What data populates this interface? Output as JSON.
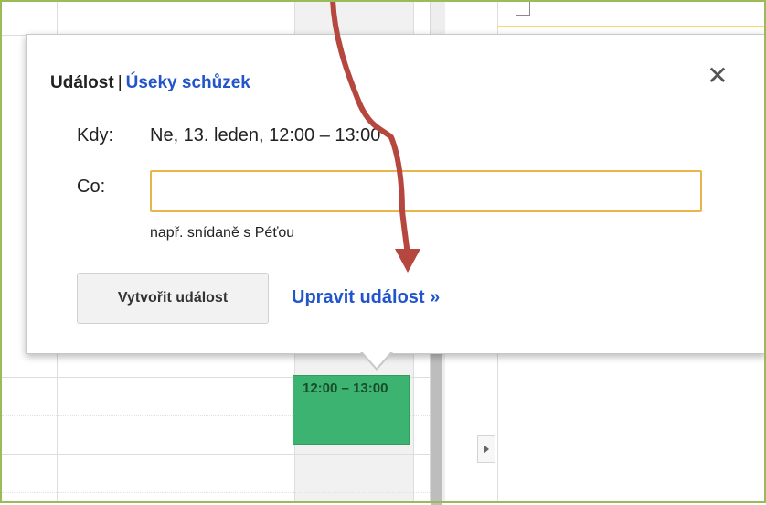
{
  "popup": {
    "title_event": "Událost",
    "title_separator": "|",
    "title_slots_link": "Úseky schůzek",
    "close_symbol": "✕",
    "when_label": "Kdy:",
    "when_value": "Ne, 13. leden, 12:00 – 13:00",
    "what_label": "Co:",
    "what_value": "",
    "what_hint": "např. snídaně s Péťou",
    "create_button": "Vytvořit událost",
    "edit_link": "Upravit událost »"
  },
  "calendar": {
    "event_time": "12:00 – 13:00"
  },
  "icons": {
    "close": "close-icon",
    "expand": "chevron-right-icon",
    "annotation": "arrow-annotation-icon"
  },
  "colors": {
    "link": "#2255cc",
    "event": "#3cb371",
    "input_border": "#e8b54c",
    "annotation_arrow": "#b5473f",
    "frame": "#9bbb59"
  }
}
